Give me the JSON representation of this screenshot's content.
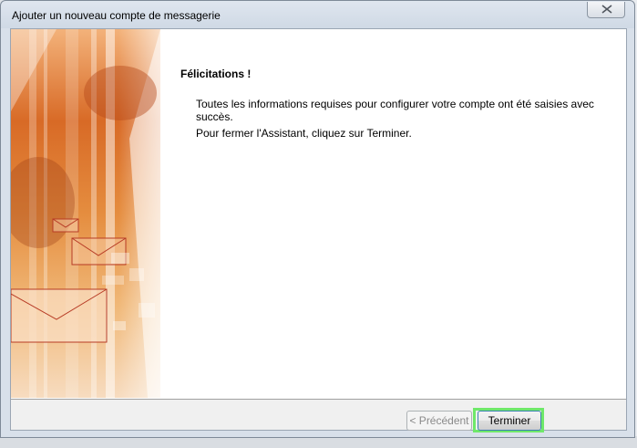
{
  "window": {
    "title": "Ajouter un nouveau compte de messagerie"
  },
  "content": {
    "heading": "Félicitations !",
    "message_success": "Toutes les informations requises pour configurer votre compte ont été saisies avec succès.",
    "message_close": "Pour fermer l'Assistant, cliquez sur Terminer."
  },
  "buttons": {
    "previous": "< Précédent",
    "finish": "Terminer"
  },
  "icons": {
    "close": "close-icon",
    "banner": "envelope-banner"
  },
  "colors": {
    "banner_orange": "#e07a2a",
    "highlight": "#6fe86a"
  }
}
